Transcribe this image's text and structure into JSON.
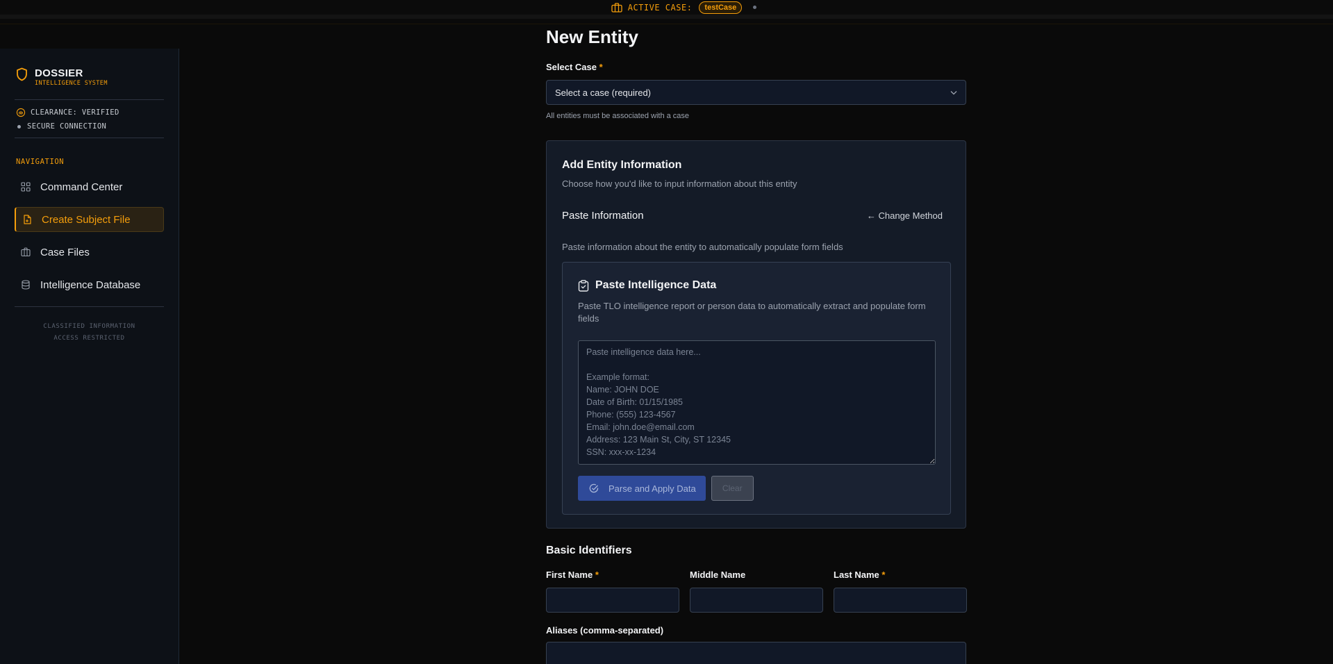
{
  "topbar": {
    "label": "ACTIVE CASE:",
    "case_name": "testCase"
  },
  "sidebar": {
    "brand_title": "DOSSIER",
    "brand_subtitle": "INTELLIGENCE SYSTEM",
    "clearance": "CLEARANCE: VERIFIED",
    "connection": "SECURE CONNECTION",
    "nav_title": "NAVIGATION",
    "items": [
      {
        "label": "Command Center",
        "icon": "grid-icon",
        "active": false
      },
      {
        "label": "Create Subject File",
        "icon": "file-plus-icon",
        "active": true
      },
      {
        "label": "Case Files",
        "icon": "briefcase-icon",
        "active": false
      },
      {
        "label": "Intelligence Database",
        "icon": "database-icon",
        "active": false
      }
    ],
    "footer_line1": "CLASSIFIED INFORMATION",
    "footer_line2": "ACCESS RESTRICTED"
  },
  "main": {
    "title": "New Entity",
    "select_case_label": "Select Case",
    "required_mark": "*",
    "select_case_value": "Select a case (required)",
    "select_case_hint": "All entities must be associated with a case",
    "card": {
      "title": "Add Entity Information",
      "subtitle": "Choose how you'd like to input information about this entity",
      "paste_title": "Paste Information",
      "change_method": "← Change Method",
      "paste_desc": "Paste information about the entity to automatically populate form fields",
      "inner": {
        "title": "Paste Intelligence Data",
        "desc": "Paste TLO intelligence report or person data to automatically extract and populate form fields",
        "placeholder": "Paste intelligence data here...\n\nExample format:\nName: JOHN DOE\nDate of Birth: 01/15/1985\nPhone: (555) 123-4567\nEmail: john.doe@email.com\nAddress: 123 Main St, City, ST 12345\nSSN: xxx-xx-1234",
        "parse_button": "Parse and Apply Data",
        "clear_button": "Clear"
      }
    },
    "basic": {
      "title": "Basic Identifiers",
      "first_name": "First Name",
      "middle_name": "Middle Name",
      "last_name": "Last Name",
      "aliases": "Aliases (comma-separated)"
    }
  },
  "colors": {
    "accent": "#f59e0b",
    "primary_button": "#2f4a99",
    "background": "#0a0a0a"
  }
}
